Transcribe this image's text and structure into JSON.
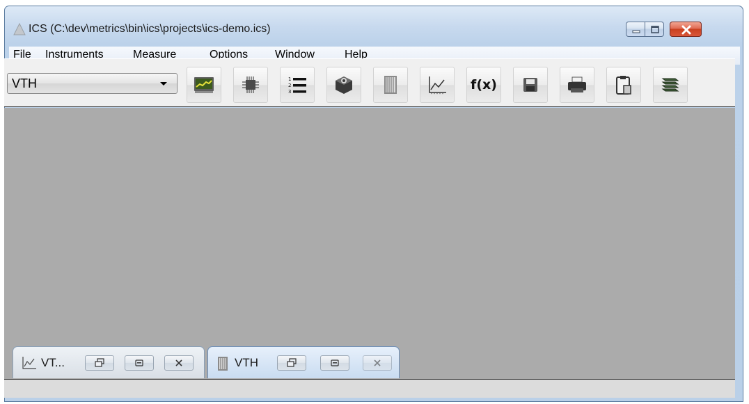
{
  "window": {
    "title": "ICS (C:\\dev\\metrics\\bin\\ics\\projects\\ics-demo.ics)"
  },
  "menu": {
    "items": [
      "File",
      "Instruments",
      "Measure",
      "Options",
      "Window",
      "Help"
    ]
  },
  "toolbar": {
    "instrument_selector_value": "VTH",
    "fx_label": "f(x)",
    "buttons": [
      {
        "icon": "instrument-display-icon"
      },
      {
        "icon": "chip-icon"
      },
      {
        "icon": "numbered-list-icon"
      },
      {
        "icon": "settings-cube-icon"
      },
      {
        "icon": "datasheet-icon"
      },
      {
        "icon": "line-chart-icon"
      },
      {
        "icon": "function-icon"
      },
      {
        "icon": "save-icon"
      },
      {
        "icon": "print-icon"
      },
      {
        "icon": "clipboard-icon"
      },
      {
        "icon": "layers-icon"
      }
    ]
  },
  "mdi": {
    "minimized_windows": [
      {
        "label": "VT...",
        "icon": "line-chart-icon"
      },
      {
        "label": "VTH",
        "icon": "datasheet-icon"
      }
    ]
  },
  "colors": {
    "workspace": "#ababab",
    "close_button": "#c9401f",
    "frame": "#bad0e8"
  }
}
